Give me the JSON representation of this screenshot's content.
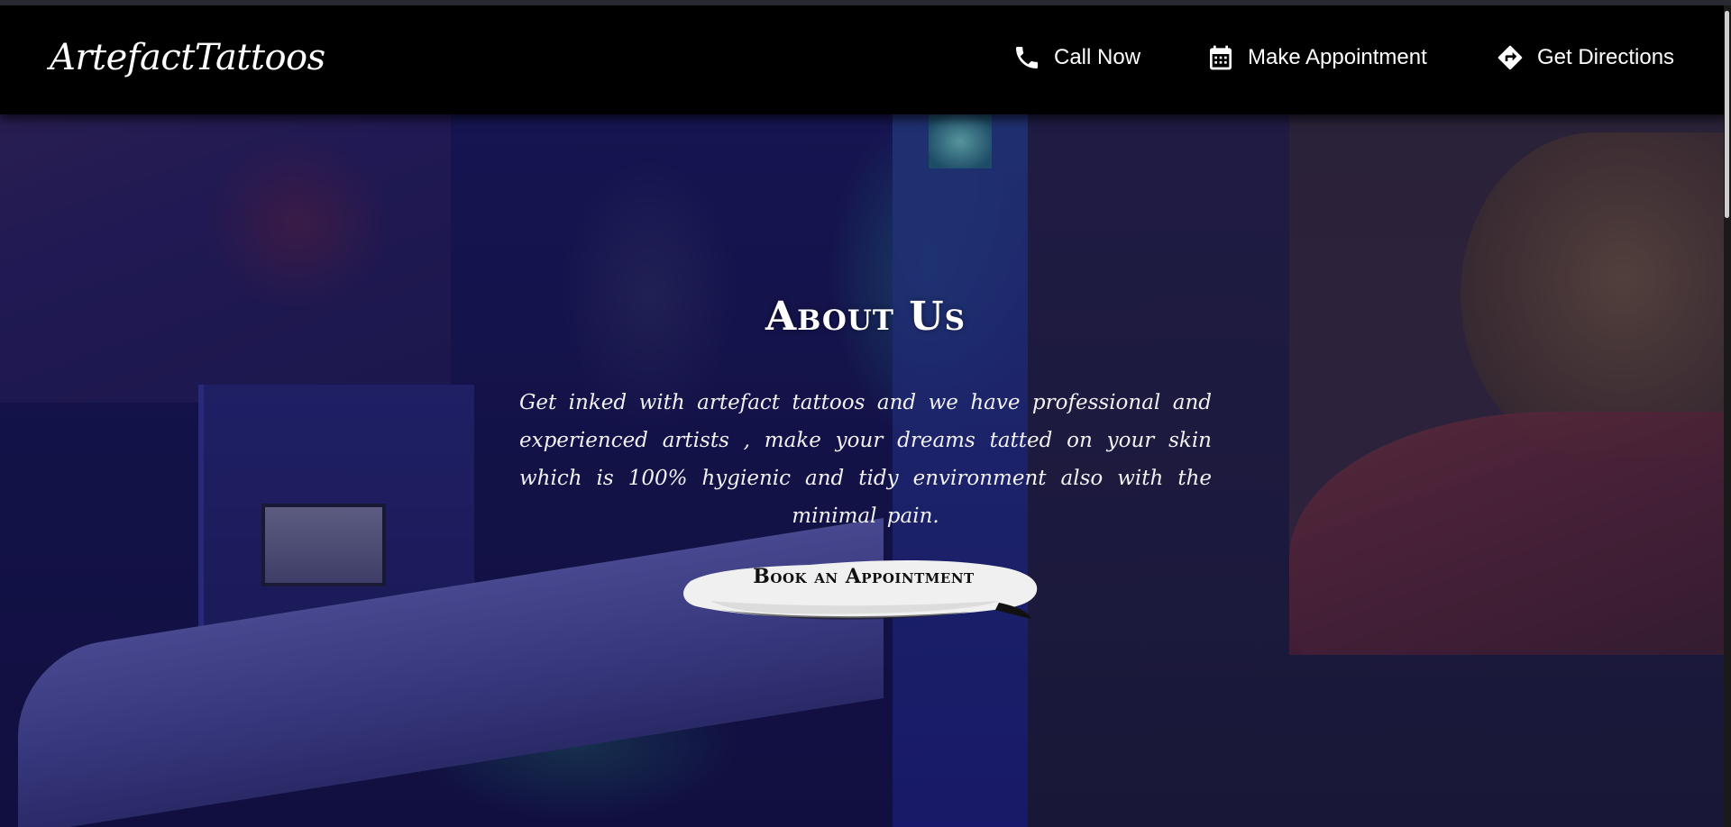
{
  "brand": {
    "name": "ArtefactTattoos"
  },
  "nav": {
    "items": [
      {
        "label": "Call Now",
        "icon": "phone-icon"
      },
      {
        "label": "Make Appointment",
        "icon": "calendar-icon"
      },
      {
        "label": "Get Directions",
        "icon": "directions-icon"
      }
    ]
  },
  "about": {
    "title": "About Us",
    "text": "Get inked with artefact tattoos and we have professional and experienced artists , make your dreams tatted on your skin which is 100% hygienic and tidy environment also with the minimal pain.",
    "button_label": "Book an Appointment"
  },
  "colors": {
    "navbar": "#000000",
    "text": "#ffffff",
    "button_paint": "#f2f2f2",
    "button_text": "#111111"
  }
}
